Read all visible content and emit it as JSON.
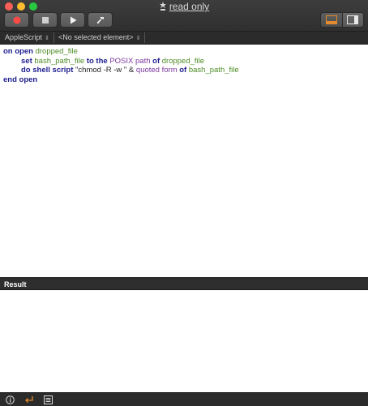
{
  "window": {
    "title": "read only"
  },
  "toolbar": {
    "buttons": [
      {
        "name": "record-button",
        "icon": "record-icon"
      },
      {
        "name": "stop-button",
        "icon": "stop-icon"
      },
      {
        "name": "run-button",
        "icon": "play-icon"
      },
      {
        "name": "compile-button",
        "icon": "hammer-icon"
      }
    ],
    "view_toggle": [
      "bottom-pane-view-icon",
      "side-pane-view-icon"
    ]
  },
  "navbar": {
    "language": "AppleScript",
    "element": "<No selected element>"
  },
  "editor": {
    "line1": {
      "kw1": "on",
      "ev": "open",
      "var": "dropped_file"
    },
    "line2": {
      "kw1": "set",
      "var1": "bash_path_file",
      "kw2": "to the",
      "cls": "POSIX path",
      "kw3": "of",
      "var2": "dropped_file"
    },
    "line3": {
      "kw1": "do shell script",
      "str": "\"chmod -R -w \"",
      "amp": "&",
      "cls": "quoted form",
      "kw2": "of",
      "var": "bash_path_file"
    },
    "line4": {
      "kw1": "end",
      "ev": "open"
    }
  },
  "result": {
    "header": "Result"
  },
  "colors": {
    "keyword": "#1d1d8f",
    "variable": "#4e8c27",
    "class": "#7d3aa0",
    "record": "#fc5f57"
  }
}
